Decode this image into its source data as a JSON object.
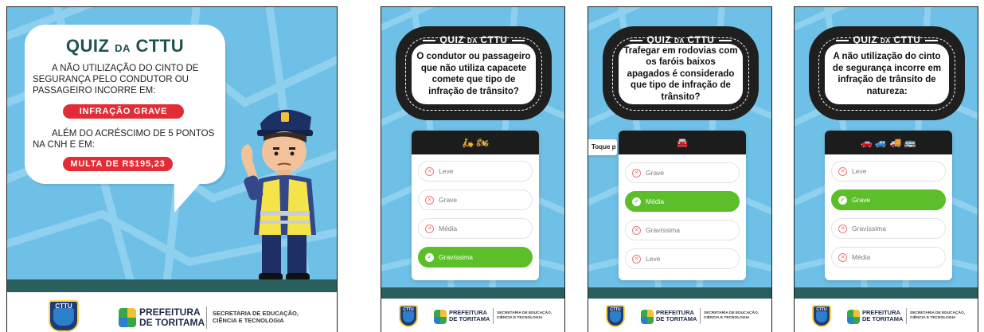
{
  "poster1": {
    "title_main": "QUIZ",
    "title_small": "DA",
    "title_end": "CTTU",
    "paragraph1": "A NÃO UTILIZAÇÃO DO CINTO  DE SEGURANÇA PELO CONDUTOR OU PASSAGEIRO INCORRE EM:",
    "pill1": "INFRAÇÃO GRAVE",
    "paragraph2": "ALÉM DO ACRÉSCIMO DE 5 PONTOS NA CNH E EM:",
    "pill2": "MULTA DE R$195,23"
  },
  "quiz_title": {
    "main": "QUIZ",
    "small": "DA",
    "end": "CTTU"
  },
  "poster2": {
    "question": "O condutor ou passageiro que não utiliza capacete comete que tipo de infração de trânsito?",
    "header_emoji": "🛵 🏍",
    "options": [
      "Leve",
      "Grave",
      "Média",
      "Gravíssima"
    ]
  },
  "poster3": {
    "question": "Trafegar em rodovias com os faróis baixos apagados é considerado que tipo de infração de trânsito?",
    "header_emoji": "🚘",
    "toque_label": "Toque p",
    "options": [
      "Grave",
      "Média",
      "Gravíssima",
      "Leve"
    ]
  },
  "poster4": {
    "question": "A não utilização do cinto de segurança incorre em infração de trânsito de natureza:",
    "header_emoji": "🚗 🚙 🚚 🚌",
    "options": [
      "Leve",
      "Grave",
      "Gravíssima",
      "Média"
    ]
  },
  "footer": {
    "shield_label": "CTTU",
    "pref_line1": "PREFEITURA",
    "pref_line2": "DE TORITAMA",
    "sec_line1": "SECRETARIA DE EDUCAÇÃO,",
    "sec_line2": "CIÊNCIA E TECNOLOGIA"
  },
  "colors": {
    "sky": "#6fc0e6",
    "teal": "#1f5351",
    "red": "#e22d36",
    "green": "#5cbf2a",
    "dark": "#1c1c1c"
  }
}
